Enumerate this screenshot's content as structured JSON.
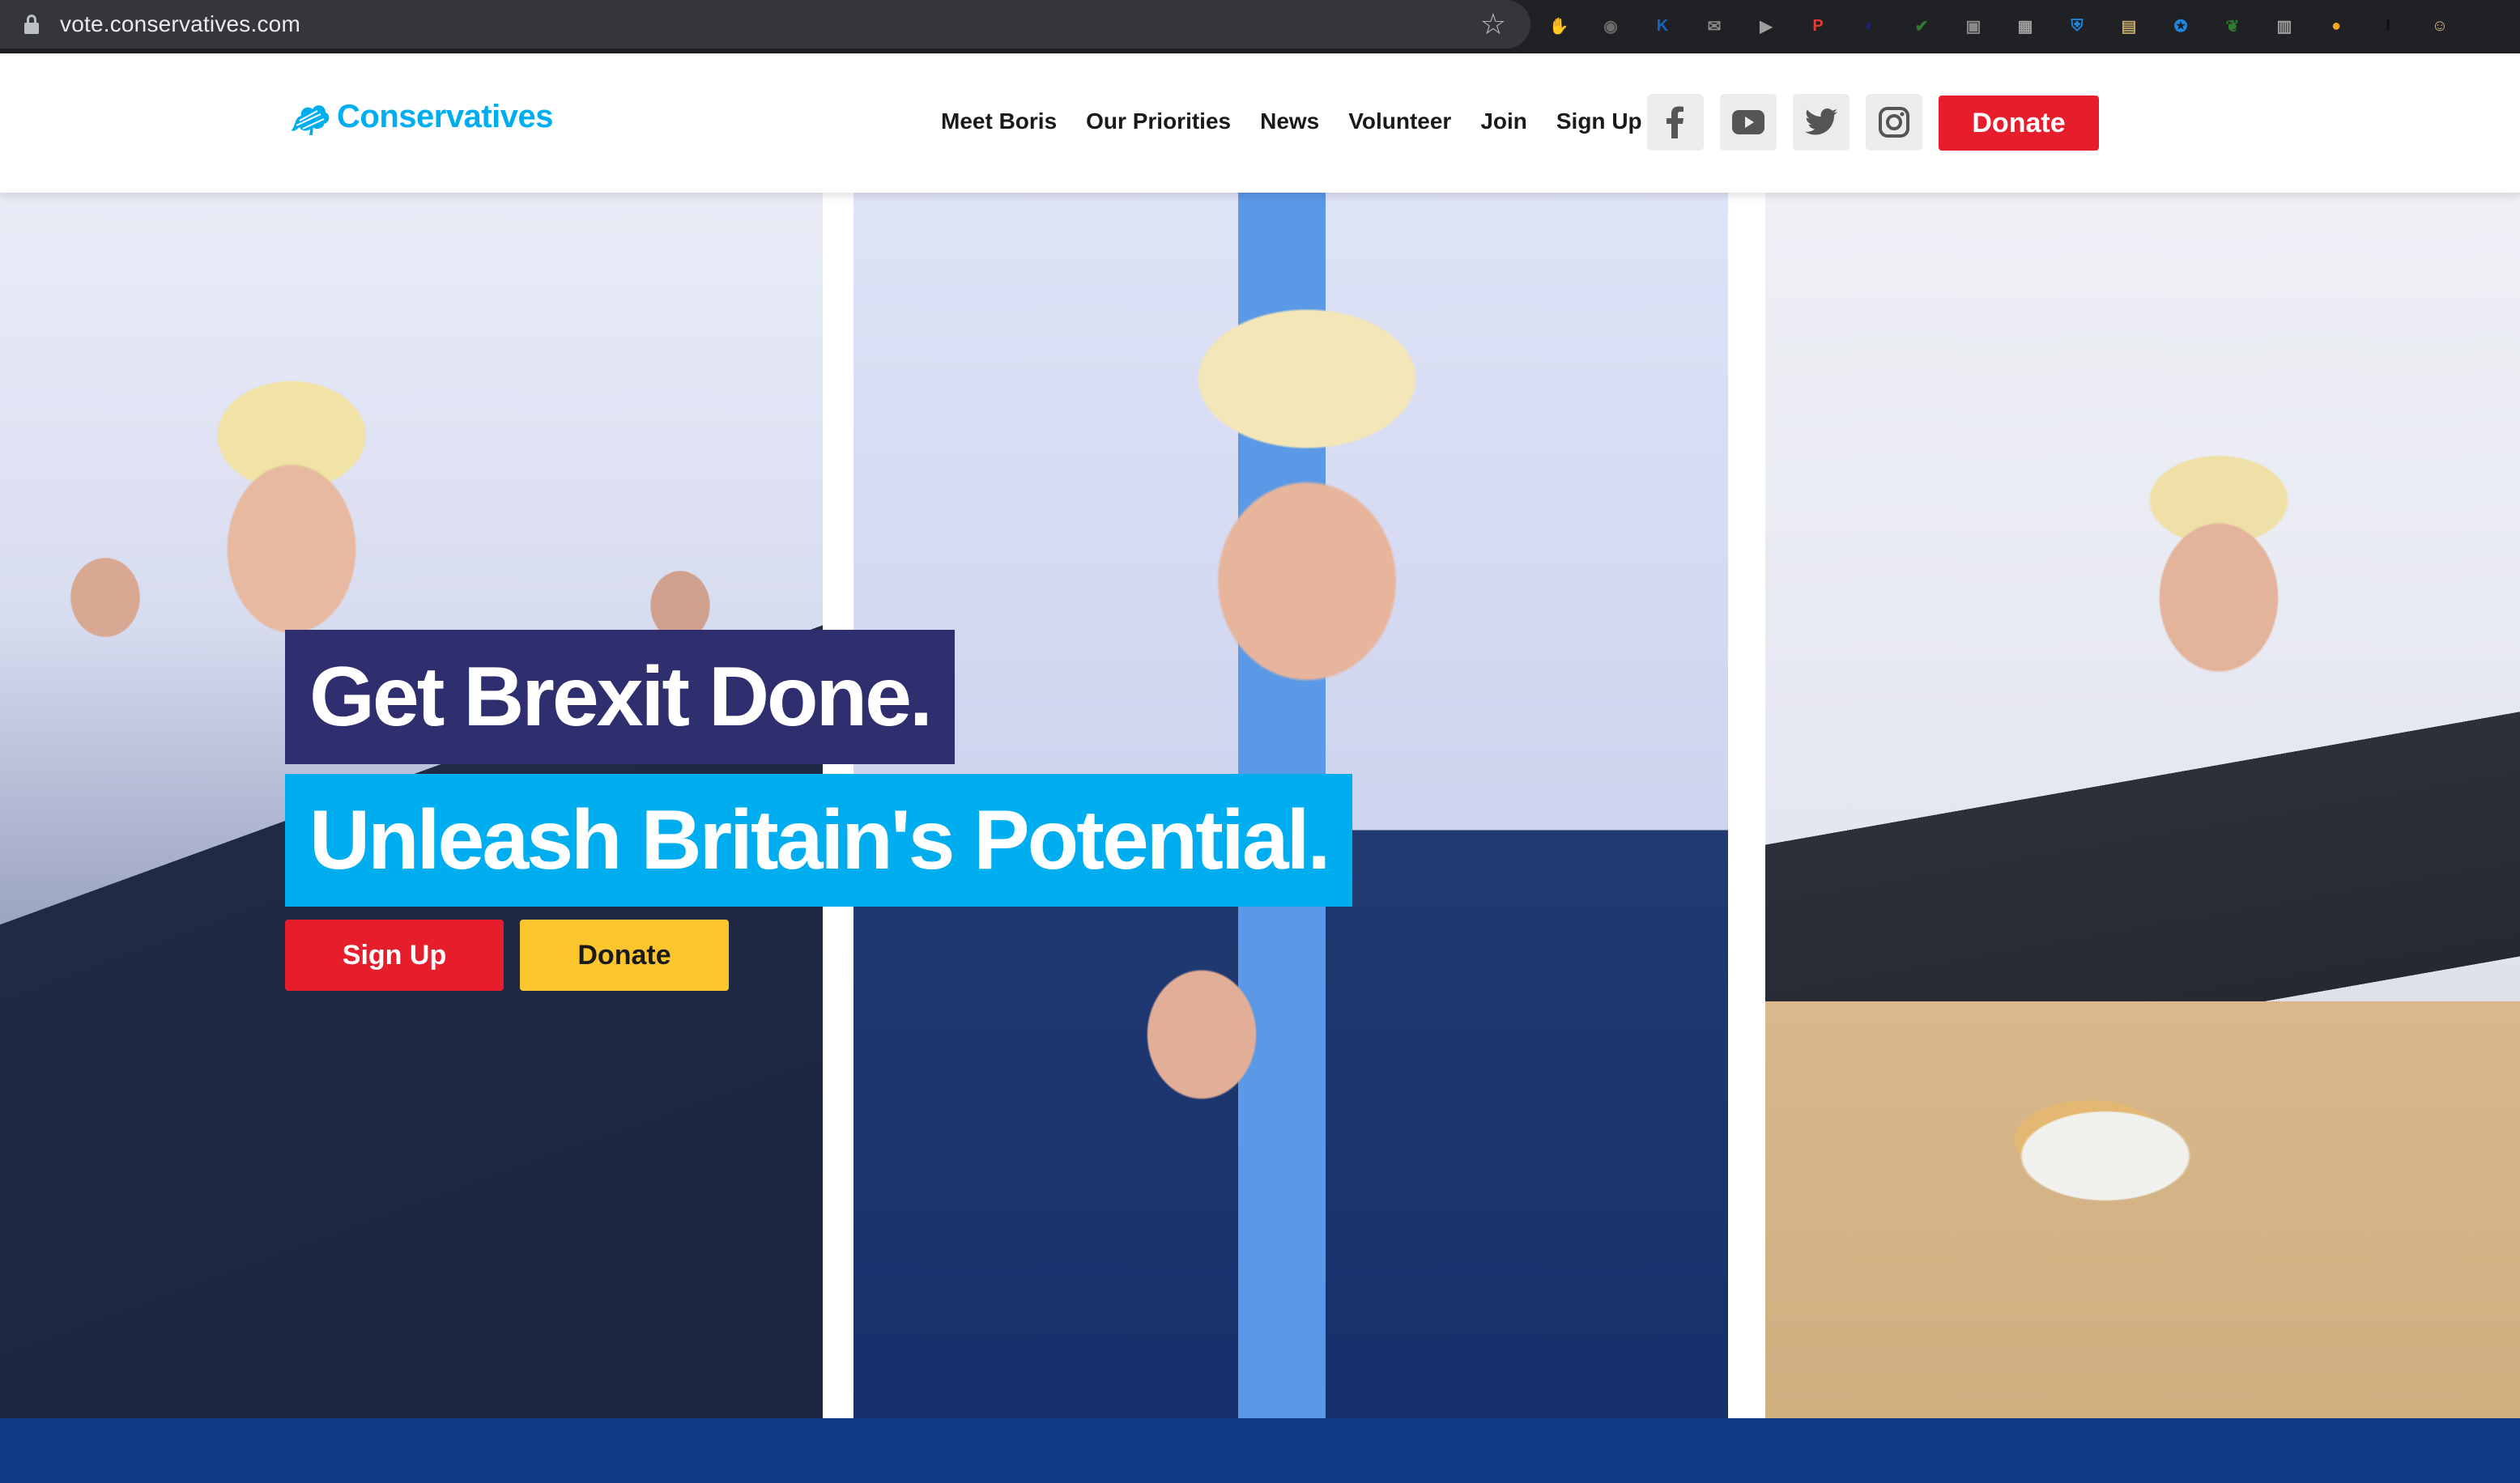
{
  "browser": {
    "url": "vote.conservatives.com",
    "extensions": [
      {
        "name": "adblock-icon",
        "glyph": "✋",
        "color": "#e53935"
      },
      {
        "name": "camera-icon",
        "glyph": "◉",
        "color": "#6b6b6b"
      },
      {
        "name": "kindle-icon",
        "glyph": "K",
        "color": "#1565c0"
      },
      {
        "name": "mail-icon",
        "glyph": "✉",
        "color": "#8a8a8a"
      },
      {
        "name": "play-icon",
        "glyph": "▶",
        "color": "#9e9e9e"
      },
      {
        "name": "pdf-icon",
        "glyph": "P",
        "color": "#e53935"
      },
      {
        "name": "search-ext-icon",
        "glyph": "◐",
        "color": "#1a237e"
      },
      {
        "name": "check-icon",
        "glyph": "✔",
        "color": "#2e7d32"
      },
      {
        "name": "screen-icon",
        "glyph": "▣",
        "color": "#8a8a8a"
      },
      {
        "name": "calendar-icon",
        "glyph": "▦",
        "color": "#9e9e9e"
      },
      {
        "name": "shield-icon",
        "glyph": "⛨",
        "color": "#1e88e5"
      },
      {
        "name": "notes-icon",
        "glyph": "▤",
        "color": "#c0a46a"
      },
      {
        "name": "compass-icon",
        "glyph": "✪",
        "color": "#1e88e5"
      },
      {
        "name": "leaf-icon",
        "glyph": "❦",
        "color": "#2e7d32"
      },
      {
        "name": "clipboard-icon",
        "glyph": "▥",
        "color": "#9e9e9e"
      },
      {
        "name": "notification-icon",
        "glyph": "●",
        "color": "#f9a825"
      },
      {
        "name": "instapaper-icon",
        "glyph": "I",
        "color": "#111111"
      },
      {
        "name": "profile-avatar-icon",
        "glyph": "☺",
        "color": "#d7b899"
      }
    ]
  },
  "header": {
    "logo_text": "Conservatives",
    "nav": [
      "Meet Boris",
      "Our Priorities",
      "News",
      "Volunteer",
      "Join",
      "Sign Up"
    ],
    "social": [
      "facebook-icon",
      "youtube-icon",
      "twitter-icon",
      "instagram-icon"
    ],
    "donate_label": "Donate"
  },
  "hero": {
    "headline_1": "Get Brexit Done.",
    "headline_2": "Unleash Britain's Potential.",
    "signup_label": "Sign Up",
    "donate_label": "Donate"
  },
  "colors": {
    "brand_blue": "#00aeef",
    "navy": "#2f2e6e",
    "donate_red": "#e61e2b",
    "donate_yellow": "#fbc52d",
    "footer_band": "#103a87"
  }
}
